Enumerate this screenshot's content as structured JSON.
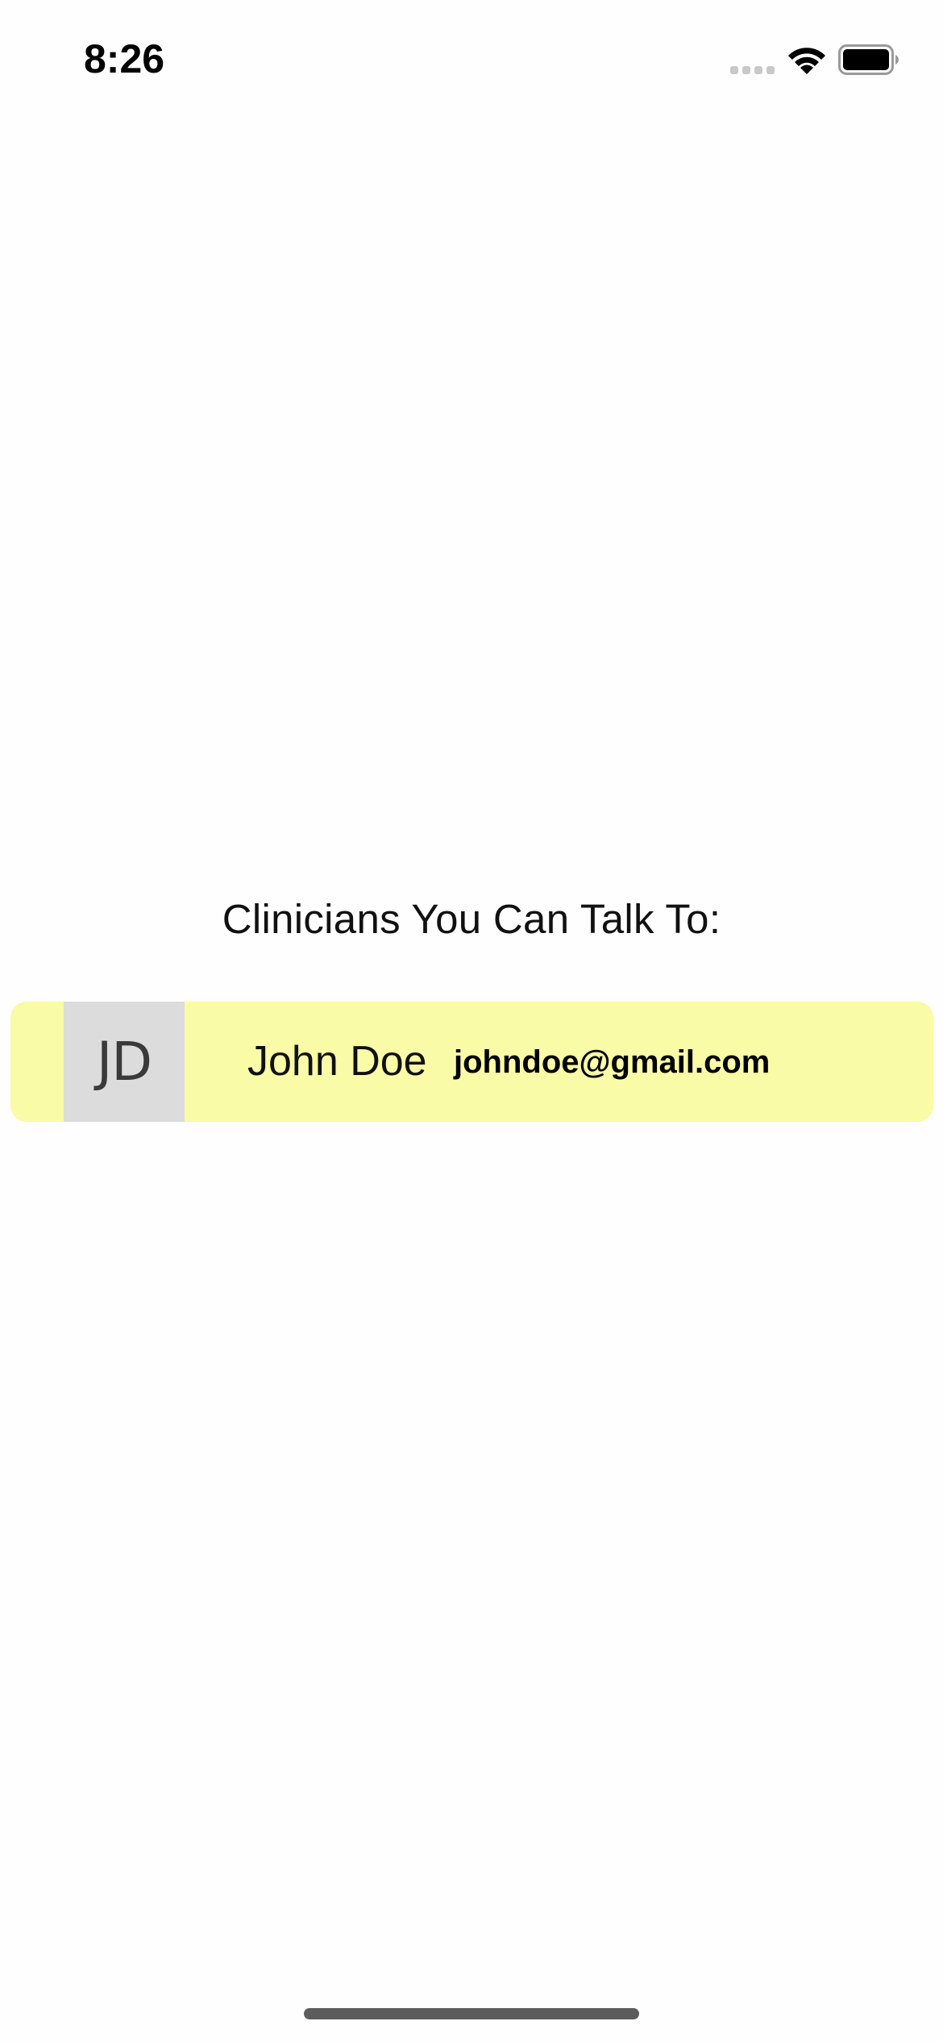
{
  "status_bar": {
    "time": "8:26",
    "signal_icon": "cellular-signal-icon",
    "wifi_icon": "wifi-icon",
    "battery_icon": "battery-icon"
  },
  "main": {
    "title": "Clinicians You Can Talk To:",
    "clinicians": [
      {
        "initials": "JD",
        "name": "John Doe",
        "email": "johndoe@gmail.com"
      }
    ]
  },
  "colors": {
    "row_background": "#f9fba6",
    "avatar_background": "#dcdcdc",
    "page_background": "#fefefe"
  }
}
